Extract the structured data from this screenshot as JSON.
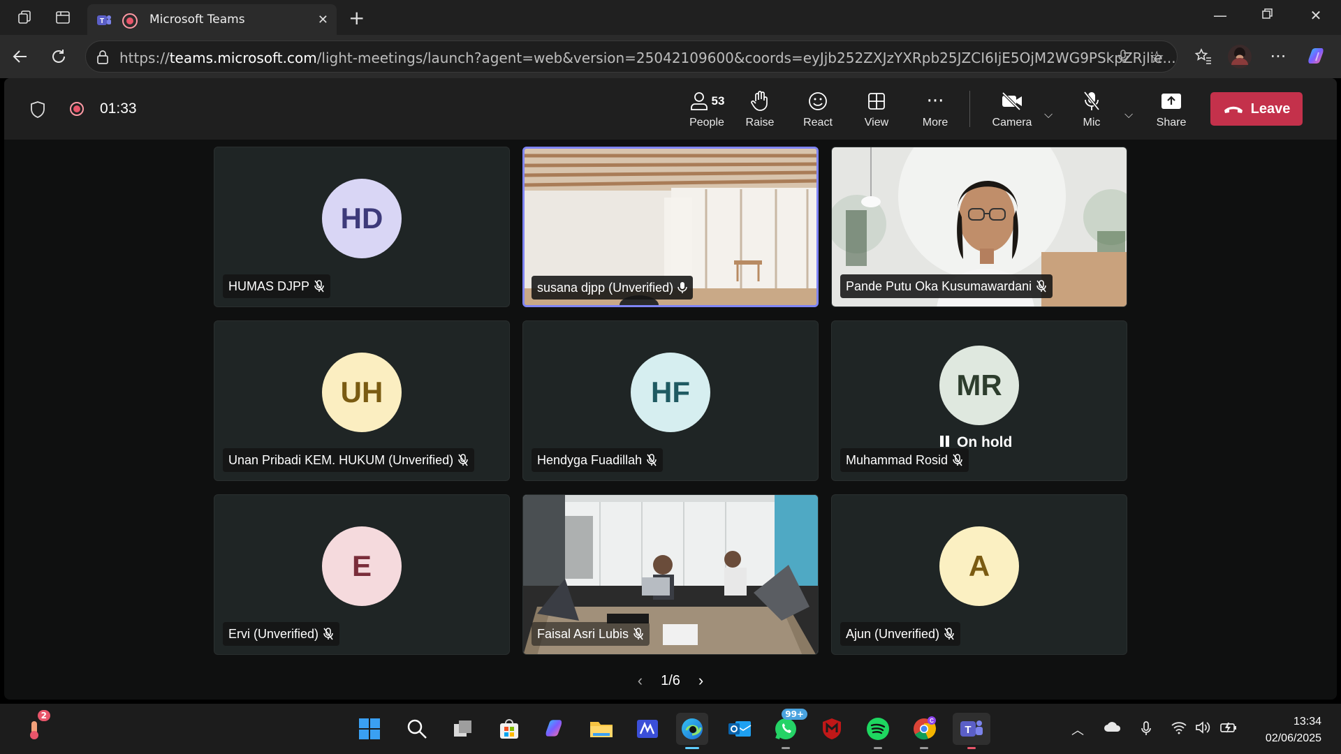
{
  "browser": {
    "tab_title": "Microsoft Teams",
    "url_prefix": "https://",
    "url_domain": "teams.microsoft.com",
    "url_rest": "/light-meetings/launch?agent=web&version=25042109600&coords=eyJjb252ZXJzYXRpb25JZCI6IjE5OjM2WG9PSkpZRjlie..."
  },
  "meeting": {
    "timer": "01:33",
    "people_count": "53",
    "toolbar": {
      "people": "People",
      "raise": "Raise",
      "react": "React",
      "view": "View",
      "more": "More",
      "camera": "Camera",
      "mic": "Mic",
      "share": "Share",
      "leave": "Leave"
    },
    "participants": [
      {
        "name": "HUMAS DJPP",
        "initials": "HD"
      },
      {
        "name": "susana djpp (Unverified)",
        "initials": ""
      },
      {
        "name": "Pande Putu Oka Kusumawardani",
        "initials": ""
      },
      {
        "name": "Unan Pribadi KEM. HUKUM (Unverified)",
        "initials": "UH"
      },
      {
        "name": "Hendyga Fuadillah",
        "initials": "HF"
      },
      {
        "name": "Muhammad Rosid",
        "initials": "MR",
        "status": "On hold"
      },
      {
        "name": "Ervi (Unverified)",
        "initials": "E"
      },
      {
        "name": "Faisal Asri Lubis",
        "initials": ""
      },
      {
        "name": "Ajun (Unverified)",
        "initials": "A"
      }
    ],
    "pager": "1/6"
  },
  "taskbar": {
    "weather_badge": "2",
    "whatsapp_badge": "99+",
    "time": "13:34",
    "date": "02/06/2025"
  },
  "colors": {
    "leave": "#c4314b",
    "active_border": "#7f85f5",
    "avatar_hd": "#d9d6f5",
    "avatar_uh": "#fbeec1",
    "avatar_hf": "#d6eef0",
    "avatar_mr": "#dfe8df",
    "avatar_e": "#f5dadd",
    "avatar_a": "#fbf0c2"
  }
}
